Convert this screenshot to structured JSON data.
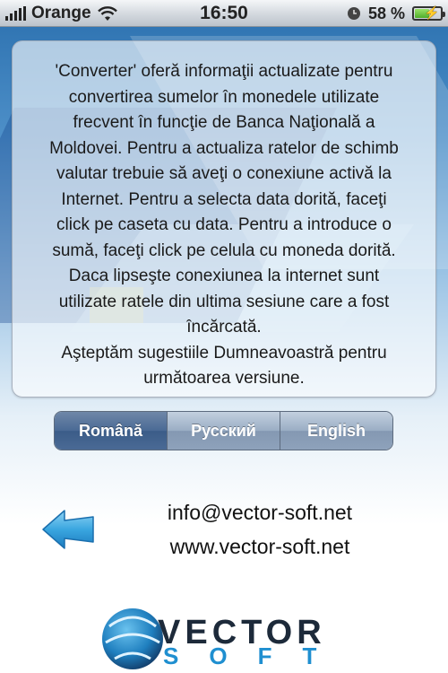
{
  "status_bar": {
    "carrier": "Orange",
    "time": "16:50",
    "battery_percent": "58 %",
    "battery_level": 0.58,
    "icons": [
      "signal-icon",
      "wifi-icon",
      "alarm-clock-icon",
      "battery-charging-icon"
    ]
  },
  "info": {
    "text": "'Converter' oferă informaţii actualizate pentru\nconvertirea sumelor în monedele utilizate\nfrecvent în funcţie de Banca Naţională a\nMoldovei. Pentru a actualiza ratelor de schimb\nvalutar trebuie să aveţi o conexiune activă la\nInternet. Pentru a selecta data dorită, faceţi\nclick pe caseta cu data. Pentru a introduce o\nsumă, faceţi click pe celula cu moneda dorită.\nDaca lipseşte conexiunea la internet sunt\nutilizate ratele  din ultima sesiune care a fost\nîncărcată.\nAşteptăm sugestiile Dumneavoastră pentru\nurmătoarea versiune."
  },
  "language_selector": {
    "options": [
      "Română",
      "Русский",
      "English"
    ],
    "selected": "Română"
  },
  "contacts": {
    "email": "info@vector-soft.net",
    "website": "www.vector-soft.net"
  },
  "logo": {
    "line1": "VECTOR",
    "line2": "SOFT"
  },
  "colors": {
    "accent_blue": "#1f8fd0",
    "segment_active": "#4a6a95",
    "segment_inactive": "#9aadc4"
  }
}
